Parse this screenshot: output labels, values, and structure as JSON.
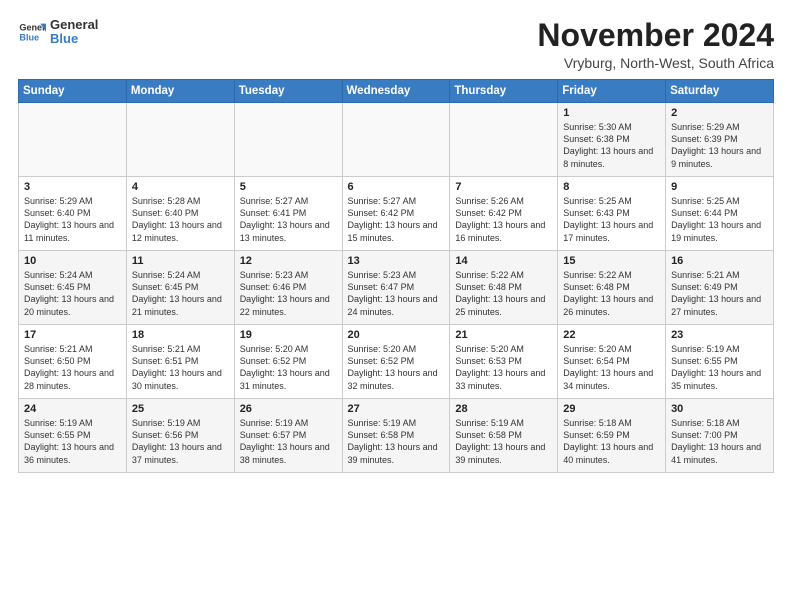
{
  "logo": {
    "general": "General",
    "blue": "Blue"
  },
  "title": "November 2024",
  "location": "Vryburg, North-West, South Africa",
  "days_of_week": [
    "Sunday",
    "Monday",
    "Tuesday",
    "Wednesday",
    "Thursday",
    "Friday",
    "Saturday"
  ],
  "weeks": [
    [
      {
        "day": "",
        "info": ""
      },
      {
        "day": "",
        "info": ""
      },
      {
        "day": "",
        "info": ""
      },
      {
        "day": "",
        "info": ""
      },
      {
        "day": "",
        "info": ""
      },
      {
        "day": "1",
        "info": "Sunrise: 5:30 AM\nSunset: 6:38 PM\nDaylight: 13 hours\nand 8 minutes."
      },
      {
        "day": "2",
        "info": "Sunrise: 5:29 AM\nSunset: 6:39 PM\nDaylight: 13 hours\nand 9 minutes."
      }
    ],
    [
      {
        "day": "3",
        "info": "Sunrise: 5:29 AM\nSunset: 6:40 PM\nDaylight: 13 hours\nand 11 minutes."
      },
      {
        "day": "4",
        "info": "Sunrise: 5:28 AM\nSunset: 6:40 PM\nDaylight: 13 hours\nand 12 minutes."
      },
      {
        "day": "5",
        "info": "Sunrise: 5:27 AM\nSunset: 6:41 PM\nDaylight: 13 hours\nand 13 minutes."
      },
      {
        "day": "6",
        "info": "Sunrise: 5:27 AM\nSunset: 6:42 PM\nDaylight: 13 hours\nand 15 minutes."
      },
      {
        "day": "7",
        "info": "Sunrise: 5:26 AM\nSunset: 6:42 PM\nDaylight: 13 hours\nand 16 minutes."
      },
      {
        "day": "8",
        "info": "Sunrise: 5:25 AM\nSunset: 6:43 PM\nDaylight: 13 hours\nand 17 minutes."
      },
      {
        "day": "9",
        "info": "Sunrise: 5:25 AM\nSunset: 6:44 PM\nDaylight: 13 hours\nand 19 minutes."
      }
    ],
    [
      {
        "day": "10",
        "info": "Sunrise: 5:24 AM\nSunset: 6:45 PM\nDaylight: 13 hours\nand 20 minutes."
      },
      {
        "day": "11",
        "info": "Sunrise: 5:24 AM\nSunset: 6:45 PM\nDaylight: 13 hours\nand 21 minutes."
      },
      {
        "day": "12",
        "info": "Sunrise: 5:23 AM\nSunset: 6:46 PM\nDaylight: 13 hours\nand 22 minutes."
      },
      {
        "day": "13",
        "info": "Sunrise: 5:23 AM\nSunset: 6:47 PM\nDaylight: 13 hours\nand 24 minutes."
      },
      {
        "day": "14",
        "info": "Sunrise: 5:22 AM\nSunset: 6:48 PM\nDaylight: 13 hours\nand 25 minutes."
      },
      {
        "day": "15",
        "info": "Sunrise: 5:22 AM\nSunset: 6:48 PM\nDaylight: 13 hours\nand 26 minutes."
      },
      {
        "day": "16",
        "info": "Sunrise: 5:21 AM\nSunset: 6:49 PM\nDaylight: 13 hours\nand 27 minutes."
      }
    ],
    [
      {
        "day": "17",
        "info": "Sunrise: 5:21 AM\nSunset: 6:50 PM\nDaylight: 13 hours\nand 28 minutes."
      },
      {
        "day": "18",
        "info": "Sunrise: 5:21 AM\nSunset: 6:51 PM\nDaylight: 13 hours\nand 30 minutes."
      },
      {
        "day": "19",
        "info": "Sunrise: 5:20 AM\nSunset: 6:52 PM\nDaylight: 13 hours\nand 31 minutes."
      },
      {
        "day": "20",
        "info": "Sunrise: 5:20 AM\nSunset: 6:52 PM\nDaylight: 13 hours\nand 32 minutes."
      },
      {
        "day": "21",
        "info": "Sunrise: 5:20 AM\nSunset: 6:53 PM\nDaylight: 13 hours\nand 33 minutes."
      },
      {
        "day": "22",
        "info": "Sunrise: 5:20 AM\nSunset: 6:54 PM\nDaylight: 13 hours\nand 34 minutes."
      },
      {
        "day": "23",
        "info": "Sunrise: 5:19 AM\nSunset: 6:55 PM\nDaylight: 13 hours\nand 35 minutes."
      }
    ],
    [
      {
        "day": "24",
        "info": "Sunrise: 5:19 AM\nSunset: 6:55 PM\nDaylight: 13 hours\nand 36 minutes."
      },
      {
        "day": "25",
        "info": "Sunrise: 5:19 AM\nSunset: 6:56 PM\nDaylight: 13 hours\nand 37 minutes."
      },
      {
        "day": "26",
        "info": "Sunrise: 5:19 AM\nSunset: 6:57 PM\nDaylight: 13 hours\nand 38 minutes."
      },
      {
        "day": "27",
        "info": "Sunrise: 5:19 AM\nSunset: 6:58 PM\nDaylight: 13 hours\nand 39 minutes."
      },
      {
        "day": "28",
        "info": "Sunrise: 5:19 AM\nSunset: 6:58 PM\nDaylight: 13 hours\nand 39 minutes."
      },
      {
        "day": "29",
        "info": "Sunrise: 5:18 AM\nSunset: 6:59 PM\nDaylight: 13 hours\nand 40 minutes."
      },
      {
        "day": "30",
        "info": "Sunrise: 5:18 AM\nSunset: 7:00 PM\nDaylight: 13 hours\nand 41 minutes."
      }
    ]
  ]
}
